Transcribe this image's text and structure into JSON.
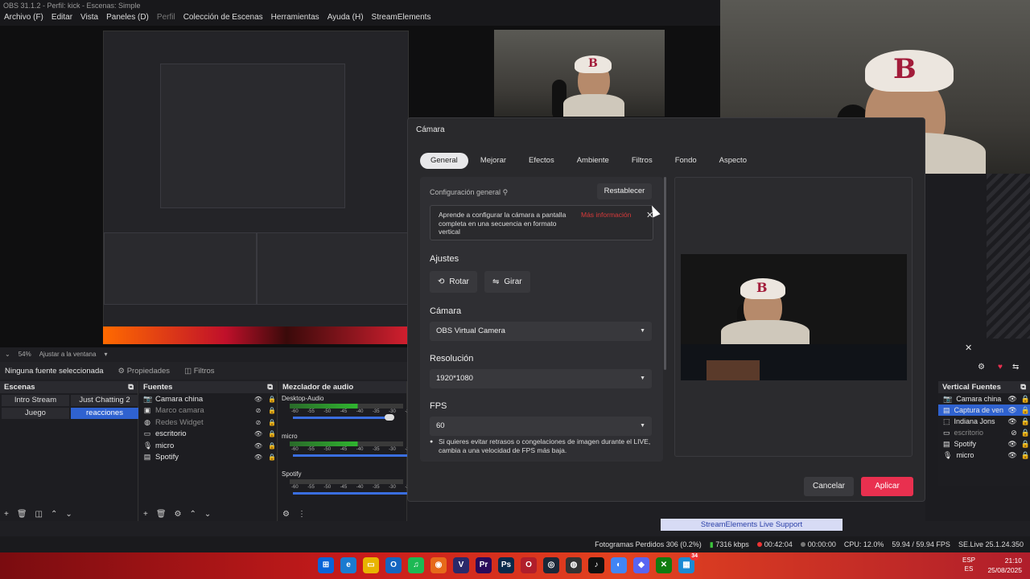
{
  "window": {
    "title": "OBS 31.1.2 - Perfil: kick - Escenas: Simple"
  },
  "menu": [
    "Archivo (F)",
    "Editar",
    "Vista",
    "Paneles (D)",
    "Perfil",
    "Colección de Escenas",
    "Herramientas",
    "Ayuda (H)",
    "StreamElements"
  ],
  "zoom": {
    "level": "54%",
    "fit_label": "Ajustar a la ventana"
  },
  "source_toolbar": {
    "selection": "Ninguna fuente seleccionada",
    "properties": "Propiedades",
    "filters": "Filtros"
  },
  "scenes": {
    "title": "Escenas",
    "items": [
      {
        "label": "Intro Stream",
        "active": false
      },
      {
        "label": "Just Chatting 2",
        "active": false
      },
      {
        "label": "Juego",
        "active": false
      },
      {
        "label": "reacciones",
        "active": true
      }
    ]
  },
  "sources": {
    "title": "Fuentes",
    "items": [
      {
        "label": "Camara china",
        "icon": "camera-icon",
        "dim": false
      },
      {
        "label": "Marco camara",
        "icon": "image-icon",
        "dim": true
      },
      {
        "label": "Redes Widget",
        "icon": "globe-icon",
        "dim": true
      },
      {
        "label": "escritorio",
        "icon": "monitor-icon",
        "dim": false
      },
      {
        "label": "micro",
        "icon": "mic-icon",
        "dim": false
      },
      {
        "label": "Spotify",
        "icon": "window-icon",
        "dim": false
      }
    ]
  },
  "mixer": {
    "title": "Mezclador de audio",
    "channels": [
      {
        "label": "Desktop-Audio",
        "level": 0.6
      },
      {
        "label": "micro",
        "level": 0.6
      },
      {
        "label": "Spotify",
        "level": 0.0
      }
    ],
    "ticks": [
      "-60",
      "-55",
      "-50",
      "-45",
      "-40",
      "-35",
      "-30",
      "-25"
    ]
  },
  "vertical_sources": {
    "title": "Vertical Fuentes",
    "items": [
      {
        "label": "Camara china",
        "selected": false,
        "dim": false
      },
      {
        "label": "Captura de ven",
        "selected": true,
        "dim": false
      },
      {
        "label": "Indiana Jons",
        "selected": false,
        "dim": false
      },
      {
        "label": "escritorio",
        "selected": false,
        "dim": true
      },
      {
        "label": "Spotify",
        "selected": false,
        "dim": false
      },
      {
        "label": "micro",
        "selected": false,
        "dim": false
      }
    ]
  },
  "streamelements": {
    "support_button": "StreamElements Live Support"
  },
  "status": {
    "dropped": "Fotogramas Perdidos 306 (0.2%)",
    "kbps": "7316 kbps",
    "live_time": "00:42:04",
    "rec_time": "00:00:00",
    "cpu": "CPU: 12.0%",
    "fps": "59.94 / 59.94 FPS",
    "se_version": "SE.Live 25.1.24.350"
  },
  "dialog": {
    "title": "Cámara",
    "tabs": [
      {
        "label": "General",
        "active": true
      },
      {
        "label": "Mejorar",
        "active": false
      },
      {
        "label": "Efectos",
        "active": false
      },
      {
        "label": "Ambiente",
        "active": false
      },
      {
        "label": "Filtros",
        "active": false
      },
      {
        "label": "Fondo",
        "active": false
      },
      {
        "label": "Aspecto",
        "active": false
      }
    ],
    "general_config_label": "Configuración general",
    "reset": "Restablecer",
    "info_text": "Aprende a configurar la cámara a pantalla completa en una secuencia en formato vertical",
    "info_link": "Más información",
    "ajustes": "Ajustes",
    "rotate": "Rotar",
    "flip": "Girar",
    "camera_label": "Cámara",
    "camera_value": "OBS Virtual Camera",
    "resolution_label": "Resolución",
    "resolution_value": "1920*1080",
    "fps_label": "FPS",
    "fps_value": "60",
    "note": "Si quieres evitar retrasos o congelaciones de imagen durante el LIVE, cambia a una velocidad de FPS más baja.",
    "cancel": "Cancelar",
    "apply": "Aplicar"
  },
  "taskbar": {
    "lang_top": "ESP",
    "lang_bottom": "ES",
    "time": "21:10",
    "date": "25/08/2025",
    "badge": "34"
  },
  "colors": {
    "accent": "#2f62d0",
    "apply": "#e9304f",
    "link": "#d83a3a"
  }
}
